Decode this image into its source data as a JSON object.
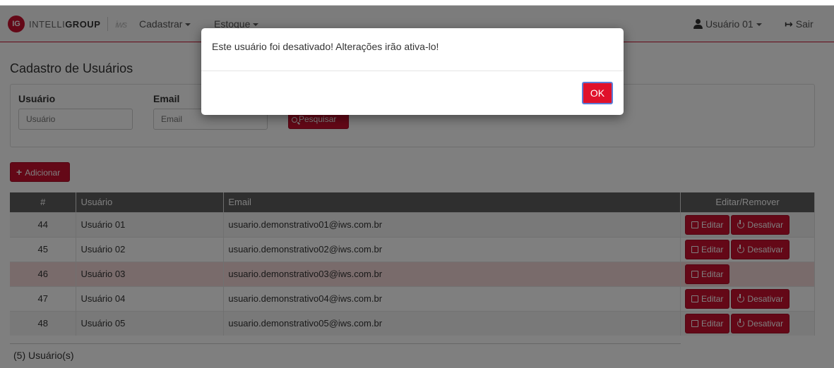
{
  "brand": {
    "badge": "IG",
    "name_light": "INTELLI",
    "name_bold": "GROUP",
    "partner_mark": "iws"
  },
  "nav": {
    "cadastrar": "Cadastrar",
    "estoque": "Estoque",
    "user": "Usuário 01",
    "logout": "Sair"
  },
  "page": {
    "title": "Cadastro de Usuários"
  },
  "filters": {
    "user_label": "Usuário",
    "user_placeholder": "Usuário",
    "email_label": "Email",
    "email_placeholder": "Email",
    "search_label": "Pesquisar"
  },
  "add_label": "Adicionar",
  "table": {
    "headers": {
      "num": "#",
      "user": "Usuário",
      "email": "Email",
      "actions": "Editar/Remover"
    },
    "edit_label": "Editar",
    "deactivate_label": "Desativar",
    "rows": [
      {
        "id": "44",
        "user": "Usuário 01",
        "email": "usuario.demonstrativo01@iws.com.br"
      },
      {
        "id": "45",
        "user": "Usuário 02",
        "email": "usuario.demonstrativo02@iws.com.br"
      },
      {
        "id": "46",
        "user": "Usuário 03",
        "email": "usuario.demonstrativo03@iws.com.br"
      },
      {
        "id": "47",
        "user": "Usuário 04",
        "email": "usuario.demonstrativo04@iws.com.br"
      },
      {
        "id": "48",
        "user": "Usuário 05",
        "email": "usuario.demonstrativo05@iws.com.br"
      }
    ]
  },
  "footer": {
    "count": "(5) Usuário(s)"
  },
  "modal": {
    "message": "Este usuário foi desativado! Alterações irão ativa-lo!",
    "ok_label": "OK"
  },
  "colors": {
    "accent": "#c8102e",
    "ok_button": "#e0112b",
    "table_header": "#5e5e5e",
    "disabled_row": "#f2d6d6"
  }
}
